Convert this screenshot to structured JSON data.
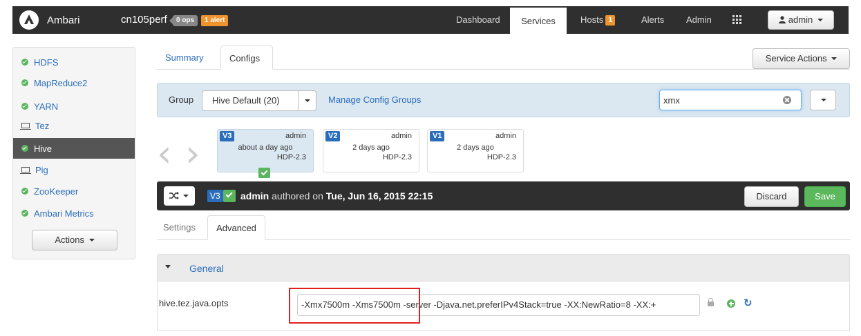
{
  "navbar": {
    "brand": "Ambari",
    "cluster": "cn105perf",
    "ops_badge": "0 ops",
    "alert_badge": "1 alert",
    "links": {
      "dashboard": "Dashboard",
      "services": "Services",
      "hosts": "Hosts",
      "alerts": "Alerts",
      "admin": "Admin"
    },
    "hosts_count": "1",
    "user_menu": "admin"
  },
  "sidebar": {
    "services": [
      {
        "label": "HDFS",
        "status": "ok"
      },
      {
        "label": "MapReduce2",
        "status": "ok"
      },
      {
        "label": "YARN",
        "status": "ok"
      },
      {
        "label": "Tez",
        "status": "client"
      },
      {
        "label": "Hive",
        "status": "ok",
        "active": true
      },
      {
        "label": "Pig",
        "status": "client"
      },
      {
        "label": "ZooKeeper",
        "status": "ok"
      },
      {
        "label": "Ambari Metrics",
        "status": "ok"
      }
    ],
    "actions_label": "Actions"
  },
  "tabs": {
    "summary": "Summary",
    "configs": "Configs"
  },
  "service_actions": "Service Actions",
  "group_bar": {
    "label": "Group",
    "selected": "Hive Default (20)",
    "manage_link": "Manage Config Groups",
    "search_value": "xmx"
  },
  "versions": [
    {
      "tag": "V3",
      "author": "admin",
      "time": "about a day ago",
      "stack": "HDP-2.3",
      "current": true
    },
    {
      "tag": "V2",
      "author": "admin",
      "time": "2 days ago",
      "stack": "HDP-2.3"
    },
    {
      "tag": "V1",
      "author": "admin",
      "time": "2 days ago",
      "stack": "HDP-2.3"
    }
  ],
  "version_bar": {
    "tag": "V3",
    "author": "admin",
    "authored_on": "authored on",
    "date": "Tue, Jun 16, 2015 22:15",
    "discard": "Discard",
    "save": "Save"
  },
  "subtabs": {
    "settings": "Settings",
    "advanced": "Advanced"
  },
  "section": {
    "title": "General",
    "property_name": "hive.tez.java.opts",
    "property_value": "-Xmx7500m -Xms7500m -server -Djava.net.preferIPv4Stack=true -XX:NewRatio=8 -XX:+"
  },
  "colors": {
    "navbar": "#2f2f2f",
    "accent": "#2a6ebb",
    "ok": "#5ab55e",
    "badge": "#f0932d",
    "highlight": "#e02020"
  }
}
